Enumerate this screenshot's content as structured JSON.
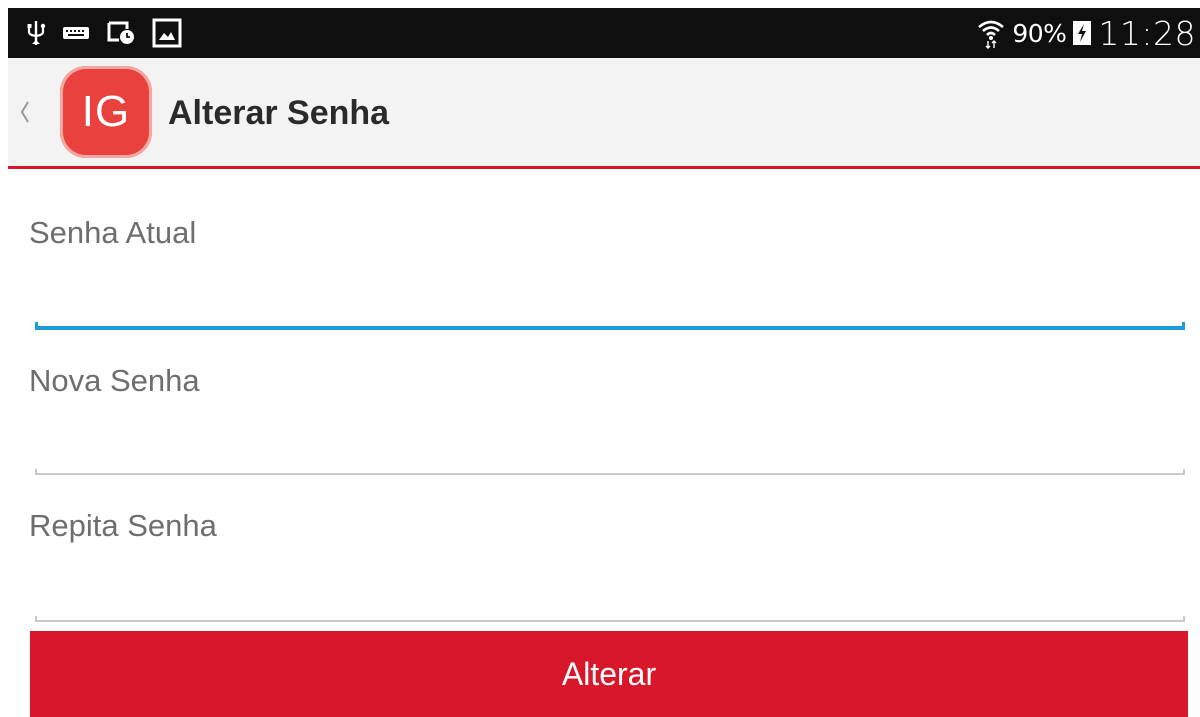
{
  "status_bar": {
    "icons": [
      "usb-icon",
      "keyboard-icon",
      "screen-timer-icon",
      "gallery-icon",
      "wifi-icon",
      "battery-charging-icon"
    ],
    "battery_percent": "90%",
    "time": "11:28"
  },
  "action_bar": {
    "logo_text": "IG",
    "title": "Alterar Senha"
  },
  "form": {
    "current_password": {
      "label": "Senha Atual",
      "value": ""
    },
    "new_password": {
      "label": "Nova Senha",
      "value": ""
    },
    "repeat_password": {
      "label": "Repita Senha",
      "value": ""
    },
    "submit_label": "Alterar"
  },
  "colors": {
    "accent": "#d8182a",
    "focus": "#1f9bd7",
    "logo": "#e8413e",
    "status_bar": "#0f0f0f",
    "action_bar": "#f3f3f3"
  }
}
